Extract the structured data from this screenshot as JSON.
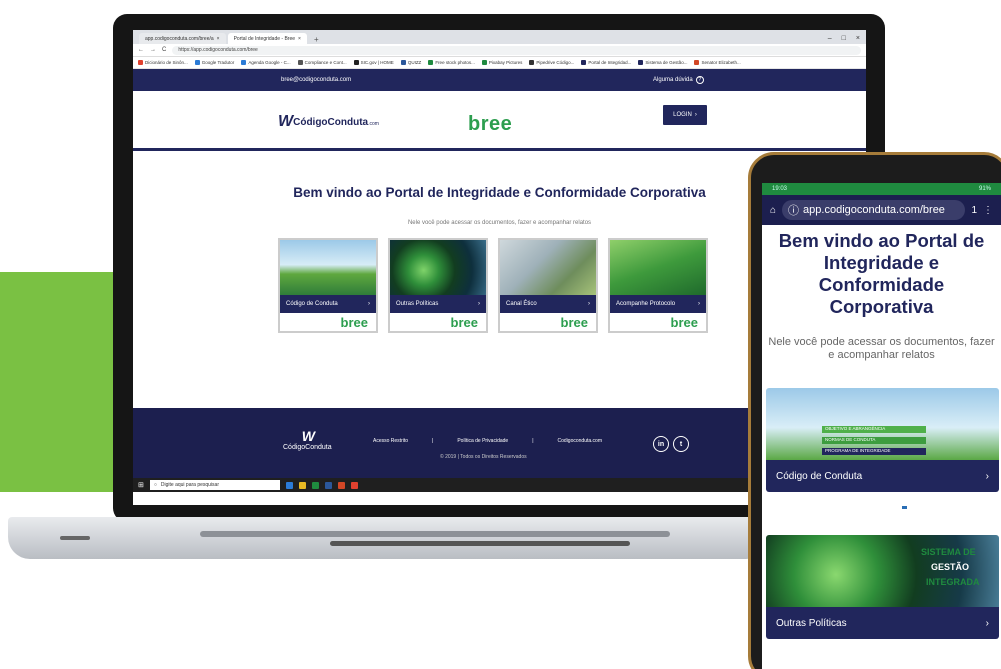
{
  "colors": {
    "green_block": "#7ac143",
    "navy": "#21265c",
    "bree_green": "#2d9e4f",
    "footer": "#1c1f4f",
    "phone_status": "#1f8a3f"
  },
  "browser": {
    "tabs": [
      "app.codigoconduta.com/bree/a",
      "Portal de Integridade - Bree"
    ],
    "new_tab": "+",
    "window_controls": [
      "–",
      "□",
      "×"
    ],
    "nav_icons": [
      "←",
      "→",
      "C"
    ],
    "url": "https://app.codigoconduta.com/bree",
    "bookmarks": [
      "Dicionário de Sinôn...",
      "Google Tradutor",
      "Agenda Google - C...",
      "Compliance e Cont...",
      "SIC.gov | HOME",
      "QUIZZ",
      "Free stock photos...",
      "Pixabay Pictures",
      "Pipedrive Código...",
      "Portal de Integridad...",
      "Sistema de Gestão...",
      "Senator Elizabeth..."
    ]
  },
  "site": {
    "email": "bree@codigoconduta.com",
    "help": "Alguma dúvida",
    "help_icon": "?",
    "logo_mark": "W",
    "logo_text": "CódigoConduta",
    "logo_suffix": ".com",
    "bree_logo": "bree",
    "login_label": "LOGIN",
    "chevron": "›",
    "welcome": "Bem vindo ao Portal de Integridade e Conformidade Corporativa",
    "subline": "Nele você pode acessar os documentos, fazer e acompanhar relatos",
    "cards": [
      {
        "label": "Código de Conduta",
        "bree": "bree"
      },
      {
        "label": "Outras Políticas",
        "bree": "bree"
      },
      {
        "label": "Canal Ético",
        "bree": "bree"
      },
      {
        "label": "Acompanhe Protocolo",
        "bree": "bree"
      }
    ],
    "footer": {
      "logo_mark": "W",
      "logo_text": "CódigoConduta",
      "links": [
        "Acesso Restrito",
        "Política de Privacidade",
        "Codigoconduta.com"
      ],
      "separator": "|",
      "copyright": "© 2019 | Todos os Direitos Reservados",
      "social": [
        "in",
        "t"
      ]
    }
  },
  "taskbar": {
    "start_icon": "⊞",
    "search_placeholder": "Digite aqui para pesquisar"
  },
  "phone": {
    "status_time": "19:03",
    "status_right": "91%",
    "home_icon": "⌂",
    "info_icon": "ⓘ",
    "url": "app.codigoconduta.com/bree",
    "tabs_icon": "1",
    "menu_icon": "⋮",
    "title": "Bem vindo ao Portal de Integridade e Conformidade Corporativa",
    "subline": "Nele você pode acessar os documentos, fazer e acompanhar relatos",
    "cards": [
      {
        "label": "Código de Conduta",
        "overlay": [
          "OBJETIVO E ABRANGÊNCIA",
          "NORMAS DE CONDUTA",
          "PROGRAMA DE INTEGRIDADE"
        ]
      },
      {
        "label": "Outras Políticas",
        "overlay": [
          "SISTEMA DE",
          "GESTÃO",
          "INTEGRADA"
        ]
      }
    ],
    "chevron": "›"
  }
}
